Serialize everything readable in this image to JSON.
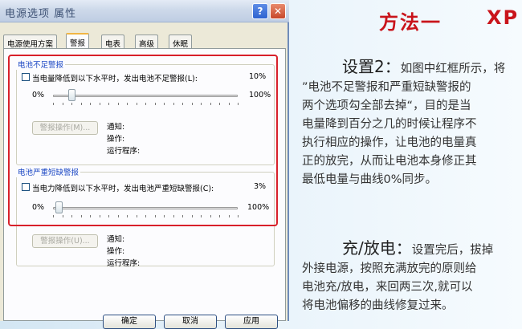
{
  "dialog": {
    "title": "电源选项 属性",
    "help_glyph": "?",
    "close_glyph": "✕",
    "tabs": [
      {
        "label": "电源使用方案"
      },
      {
        "label": "警报"
      },
      {
        "label": "电表"
      },
      {
        "label": "高级"
      },
      {
        "label": "休眠"
      }
    ],
    "low_alarm": {
      "group_title": "电池不足警报",
      "checkbox_label": "当电量降低到以下水平时，发出电池不足警报(L):",
      "value_text": "10%",
      "slider_min": "0%",
      "slider_max": "100%",
      "slider_value_percent": 10,
      "action_button": "警报操作(M)...",
      "notify_label": "通知:",
      "action_label": "操作:",
      "program_label": "运行程序:"
    },
    "critical_alarm": {
      "group_title": "电池严重短缺警报",
      "checkbox_label": "当电力降低到以下水平时，发出电池严重短缺警报(C):",
      "value_text": "3%",
      "slider_min": "0%",
      "slider_max": "100%",
      "slider_value_percent": 3,
      "action_button": "警报操作(U)...",
      "notify_label": "通知:",
      "action_label": "操作:",
      "program_label": "运行程序:"
    },
    "buttons": {
      "ok": "确定",
      "cancel": "取消",
      "apply": "应用"
    }
  },
  "article": {
    "headline": "方法一",
    "headline_suffix": "XP",
    "setting_lead": "设置2：",
    "setting_lines": [
      "如图中红框所示，将",
      "”电池不足警报和严重短缺警报的",
      "两个选项勾全部去掉“，目的是当",
      "电量降到百分之几的时候让程序不",
      "执行相应的操作，让电池的电量真",
      "正的放完，从而让电池本身修正其",
      "最低电量与曲线0%同步。"
    ],
    "charge_lead": "充/放电：",
    "charge_lines": [
      "设置完后，拔掉",
      "外接电源，按照充满放完的原则给",
      "电池充/放电，来回两三次,就可以",
      "将电池偏移的曲线修复过来。"
    ]
  }
}
